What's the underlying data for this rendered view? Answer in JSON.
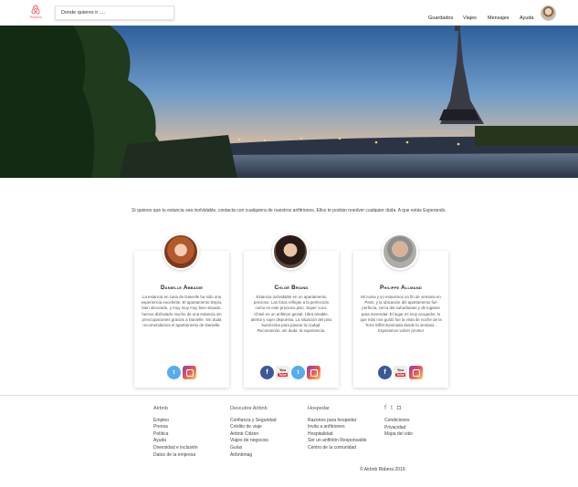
{
  "header": {
    "logo_text": "Rbbera",
    "search_placeholder": "Donde quieres ir ....",
    "nav": [
      "Guardados",
      "Viajes",
      "Mensajes",
      "Ayuda"
    ]
  },
  "intro": "Si quieres que tu estancia sea inolvidable, contacta con cualquiera de nuestros anfitriones. Ellos te podrán resolver cualquier duda. A que estás Esperando.",
  "hosts": [
    {
      "name": "Danielle Abbadie",
      "text": "La estancia en casa de Danielle ha sido una experiencia excelente. El apartamento limpio, bien decorado, y muy muy muy bien situado, hemos disfrutado mucho de una estancia sin preocupaciones gracias a Danielle. Sin duda recomendamos el apartamento de Danielle.",
      "social": [
        "twitter-icon",
        "instagram-icon"
      ]
    },
    {
      "name": "Chloé Briand",
      "text": "Estancia inolvidable en un apartamento precioso. Las fotos reflejan a la perfección como es este precioso piso. Super cuco. Chloé es un anfitrion genial. Ultra amable, atenta y sujer dispuesta. La situacion del piso buenísima para pasear la ciudad. Recomiendo, sin duda, la experiencia.",
      "social": [
        "facebook-icon",
        "youtube-icon",
        "twitter-icon",
        "instagram-icon"
      ]
    },
    {
      "name": "Philippe Allmand",
      "text": "Mi novia y yo estuvimos un fin de semana en Paris, y la ubicación del apartamento fué perfecta, cerca del suburbanas y de lugares para merendar. El lugar es muy acogedor, lo que más nos gustó fue la vista de noche de la Torre Eiffel iluminada desde la ventana . Esperamos volver pronto!",
      "social": [
        "facebook-icon",
        "youtube-icon",
        "instagram-icon"
      ]
    }
  ],
  "youtube_label": "You",
  "youtube_sub": "Tube",
  "footer": {
    "columns": [
      {
        "heading": "Airbnb",
        "items": [
          "Empleo",
          "Prensa",
          "Política",
          "Ayuda",
          "Diversidad e inclusión",
          "Datos de la empresa"
        ]
      },
      {
        "heading": "Descubre Airbnb",
        "items": [
          "Confianza y Seguridad",
          "Crédito de viaje",
          "Airbnb Citizen",
          "Viajes de negocios",
          "Guías",
          "Airbnbmag"
        ]
      },
      {
        "heading": "Hospedar",
        "items": [
          "Razones para hospedar",
          "Invita a anfitriones",
          "Hospitalidad",
          "Ser un anfitrión Responsable",
          "Centro de la comunidad"
        ]
      },
      {
        "heading": "",
        "items": [
          "Condiciones",
          "Privacidad",
          "Mapa del sitio"
        ]
      }
    ],
    "social_icons": [
      "facebook-icon",
      "twitter-icon",
      "instagram-icon"
    ],
    "copyright": "© Airbnb Rbbera 2019."
  }
}
